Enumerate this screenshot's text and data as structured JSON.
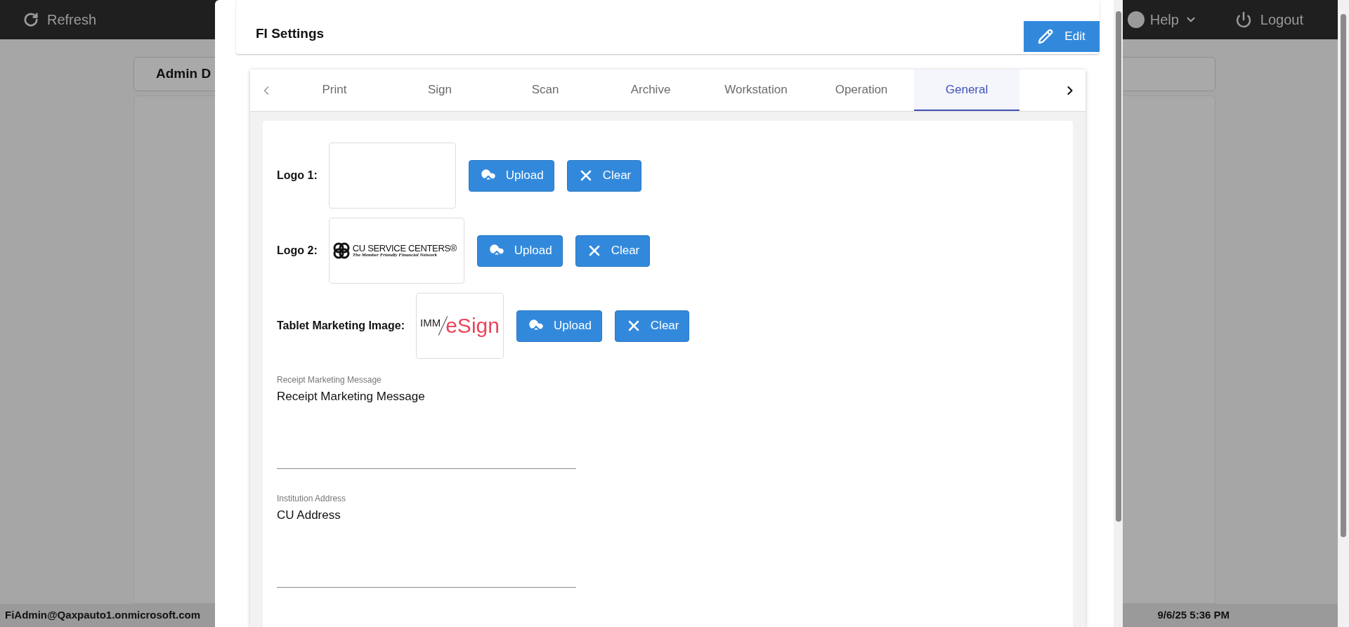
{
  "top_bar": {
    "refresh": "Refresh",
    "help": "Help",
    "logout": "Logout"
  },
  "background_card": {
    "title": "Admin D"
  },
  "status_bar": {
    "user": "FiAdmin@Qaxpauto1.onmicrosoft.com",
    "datetime": "9/6/25 5:36 PM"
  },
  "dialog": {
    "title": "FI Settings",
    "edit_button": "Edit",
    "tabs": [
      {
        "label": "Print",
        "selected": false
      },
      {
        "label": "Sign",
        "selected": false
      },
      {
        "label": "Scan",
        "selected": false
      },
      {
        "label": "Archive",
        "selected": false
      },
      {
        "label": "Workstation",
        "selected": false
      },
      {
        "label": "Operation",
        "selected": false
      },
      {
        "label": "General",
        "selected": true
      }
    ],
    "image_rows": [
      {
        "label": "Logo 1:",
        "kind": "empty",
        "upload": "Upload",
        "clear": "Clear"
      },
      {
        "label": "Logo 2:",
        "kind": "cu-logo",
        "logo_title": "CU SERVICE CENTERS®",
        "logo_tagline": "The Member Friendly Financial Network",
        "upload": "Upload",
        "clear": "Clear"
      },
      {
        "label": "Tablet Marketing Image:",
        "kind": "esign-logo",
        "logo_prefix": "IMM",
        "logo_name": "eSign",
        "upload": "Upload",
        "clear": "Clear"
      }
    ],
    "fields": [
      {
        "label": "Receipt Marketing Message",
        "value": "Receipt Marketing Message"
      },
      {
        "label": "Institution Address",
        "value": "CU Address"
      }
    ]
  }
}
